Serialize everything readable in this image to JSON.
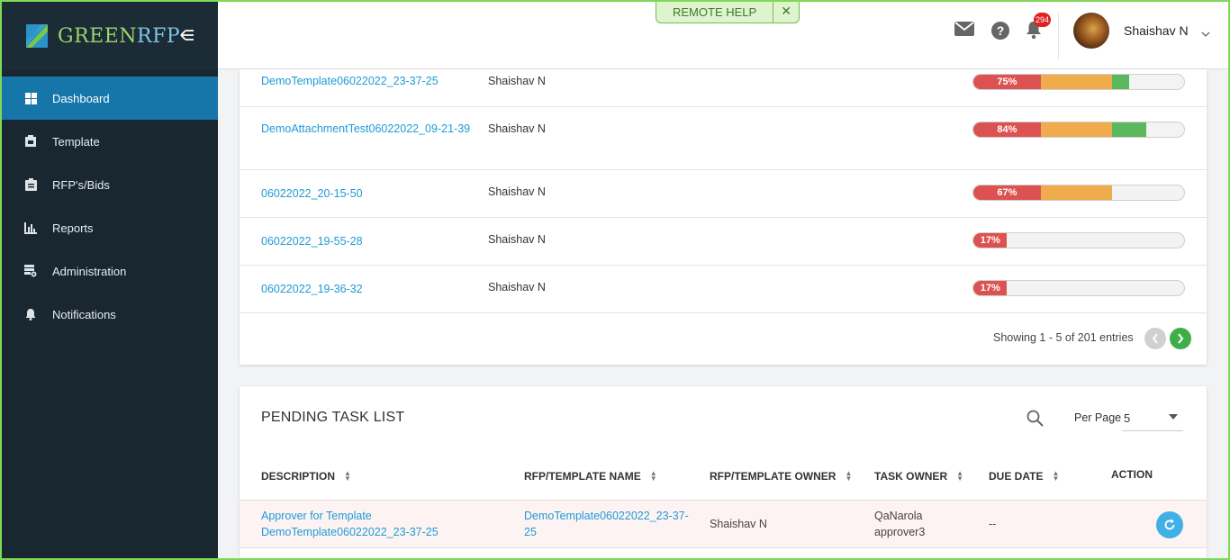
{
  "app": {
    "brand_left": "GREEN",
    "brand_right": "RFP"
  },
  "sidebar": {
    "items": [
      {
        "label": "Dashboard",
        "icon": "dashboard-icon"
      },
      {
        "label": "Template",
        "icon": "template-icon"
      },
      {
        "label": "RFP's/Bids",
        "icon": "clipboard-icon"
      },
      {
        "label": "Reports",
        "icon": "bar-chart-icon"
      },
      {
        "label": "Administration",
        "icon": "admin-icon"
      },
      {
        "label": "Notifications",
        "icon": "bell-icon"
      }
    ]
  },
  "header": {
    "remote_help": "REMOTE HELP",
    "remote_close": "✕",
    "notification_count": "294",
    "user_name": "Shaishav N"
  },
  "rfp_table": {
    "rows": [
      {
        "name": "DemoTemplate06022022_23-37-25",
        "owner": "Shaishav N",
        "progress_label": "75%",
        "red": 32,
        "orange": 34,
        "green": 8
      },
      {
        "name": "DemoAttachmentTest06022022_09-21-39",
        "owner": "Shaishav N",
        "progress_label": "84%",
        "red": 32,
        "orange": 34,
        "green": 16
      },
      {
        "name": "06022022_20-15-50",
        "owner": "Shaishav N",
        "progress_label": "67%",
        "red": 32,
        "orange": 34,
        "green": 0
      },
      {
        "name": "06022022_19-55-28",
        "owner": "Shaishav N",
        "progress_label": "17%",
        "red": 16,
        "orange": 0,
        "green": 0
      },
      {
        "name": "06022022_19-36-32",
        "owner": "Shaishav N",
        "progress_label": "17%",
        "red": 16,
        "orange": 0,
        "green": 0
      }
    ],
    "pager_text": "Showing 1 - 5 of 201 entries"
  },
  "pending": {
    "title": "PENDING TASK LIST",
    "per_page_label": "Per Page",
    "per_page_value": "5",
    "columns": {
      "description": "DESCRIPTION",
      "rfp_name": "RFP/TEMPLATE NAME",
      "rfp_owner": "RFP/TEMPLATE OWNER",
      "task_owner": "TASK OWNER",
      "due_date": "DUE DATE",
      "action": "ACTION"
    },
    "rows": [
      {
        "description": "Approver for Template DemoTemplate06022022_23-37-25",
        "rfp_name": "DemoTemplate06022022_23-37-25",
        "rfp_owner": "Shaishav N",
        "task_owner": "QaNarola approver3",
        "due_date": "--"
      }
    ]
  },
  "colors": {
    "sidebar": "#182730",
    "active": "#1675a9",
    "link": "#1e9bd7",
    "red": "#dc5250",
    "orange": "#efab4c",
    "green": "#5cb85c"
  }
}
